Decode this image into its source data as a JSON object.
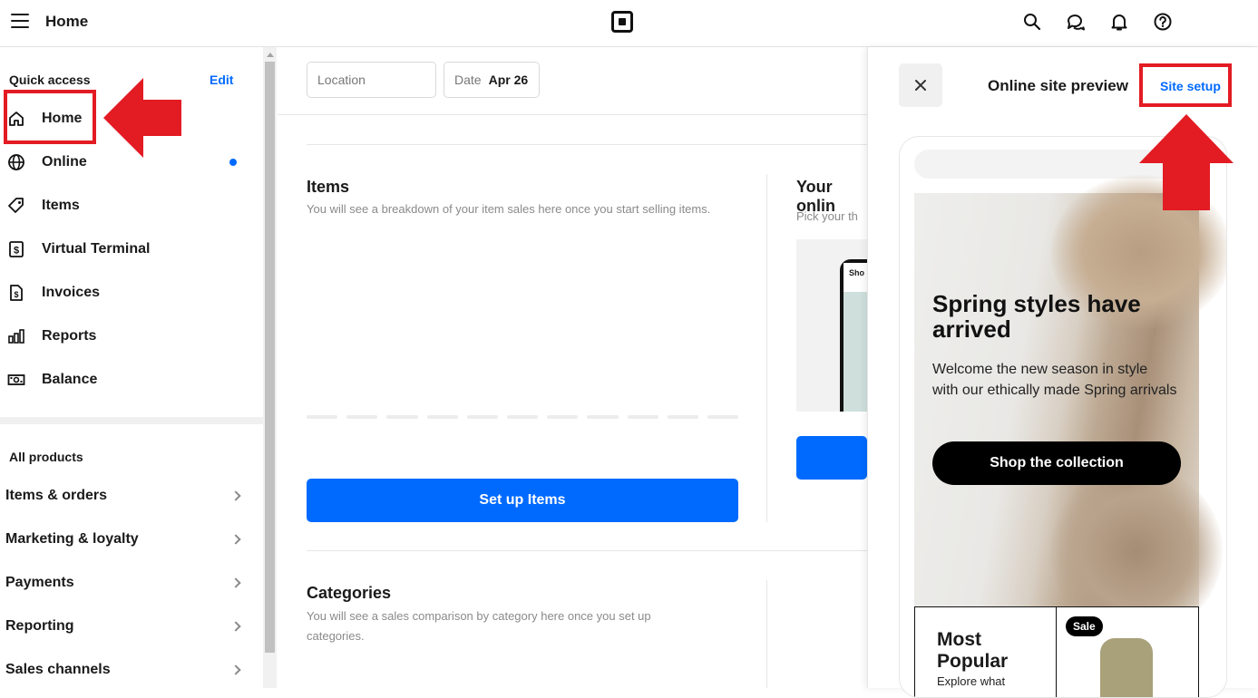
{
  "topbar": {
    "title": "Home"
  },
  "sidebar": {
    "quick_access_title": "Quick access",
    "edit_label": "Edit",
    "items": [
      {
        "label": "Home",
        "icon": "home-icon"
      },
      {
        "label": "Online",
        "icon": "globe-icon"
      },
      {
        "label": "Items",
        "icon": "tag-icon"
      },
      {
        "label": "Virtual Terminal",
        "icon": "dollar-terminal-icon"
      },
      {
        "label": "Invoices",
        "icon": "invoice-icon"
      },
      {
        "label": "Reports",
        "icon": "bar-chart-icon"
      },
      {
        "label": "Balance",
        "icon": "cash-icon"
      }
    ],
    "all_products_title": "All products",
    "products": [
      {
        "label": "Items & orders"
      },
      {
        "label": "Marketing & loyalty"
      },
      {
        "label": "Payments"
      },
      {
        "label": "Reporting"
      },
      {
        "label": "Sales channels"
      }
    ]
  },
  "main": {
    "location_placeholder": "Location",
    "date_label": "Date",
    "date_value": "Apr 26",
    "items_title": "Items",
    "items_desc": "You will see a breakdown of your item sales here once you start selling items.",
    "setup_items_button": "Set up Items",
    "online_title": "Your onlin",
    "online_desc": "Pick your th",
    "phone_label": "Sho",
    "categories_title": "Categories",
    "categories_desc": "You will see a sales comparison by category here once you set up categories."
  },
  "panel": {
    "title": "Online site preview",
    "site_setup_label": "Site setup",
    "hero_title": "Spring styles have arrived",
    "hero_text": "Welcome the new season in style with our ethically made Spring arrivals",
    "hero_button": "Shop the collection",
    "tile_title": "Most Popular",
    "tile_sub": "Explore what",
    "sale_badge": "Sale"
  },
  "colors": {
    "accent": "#006aff",
    "annotation_red": "#e31b23"
  }
}
